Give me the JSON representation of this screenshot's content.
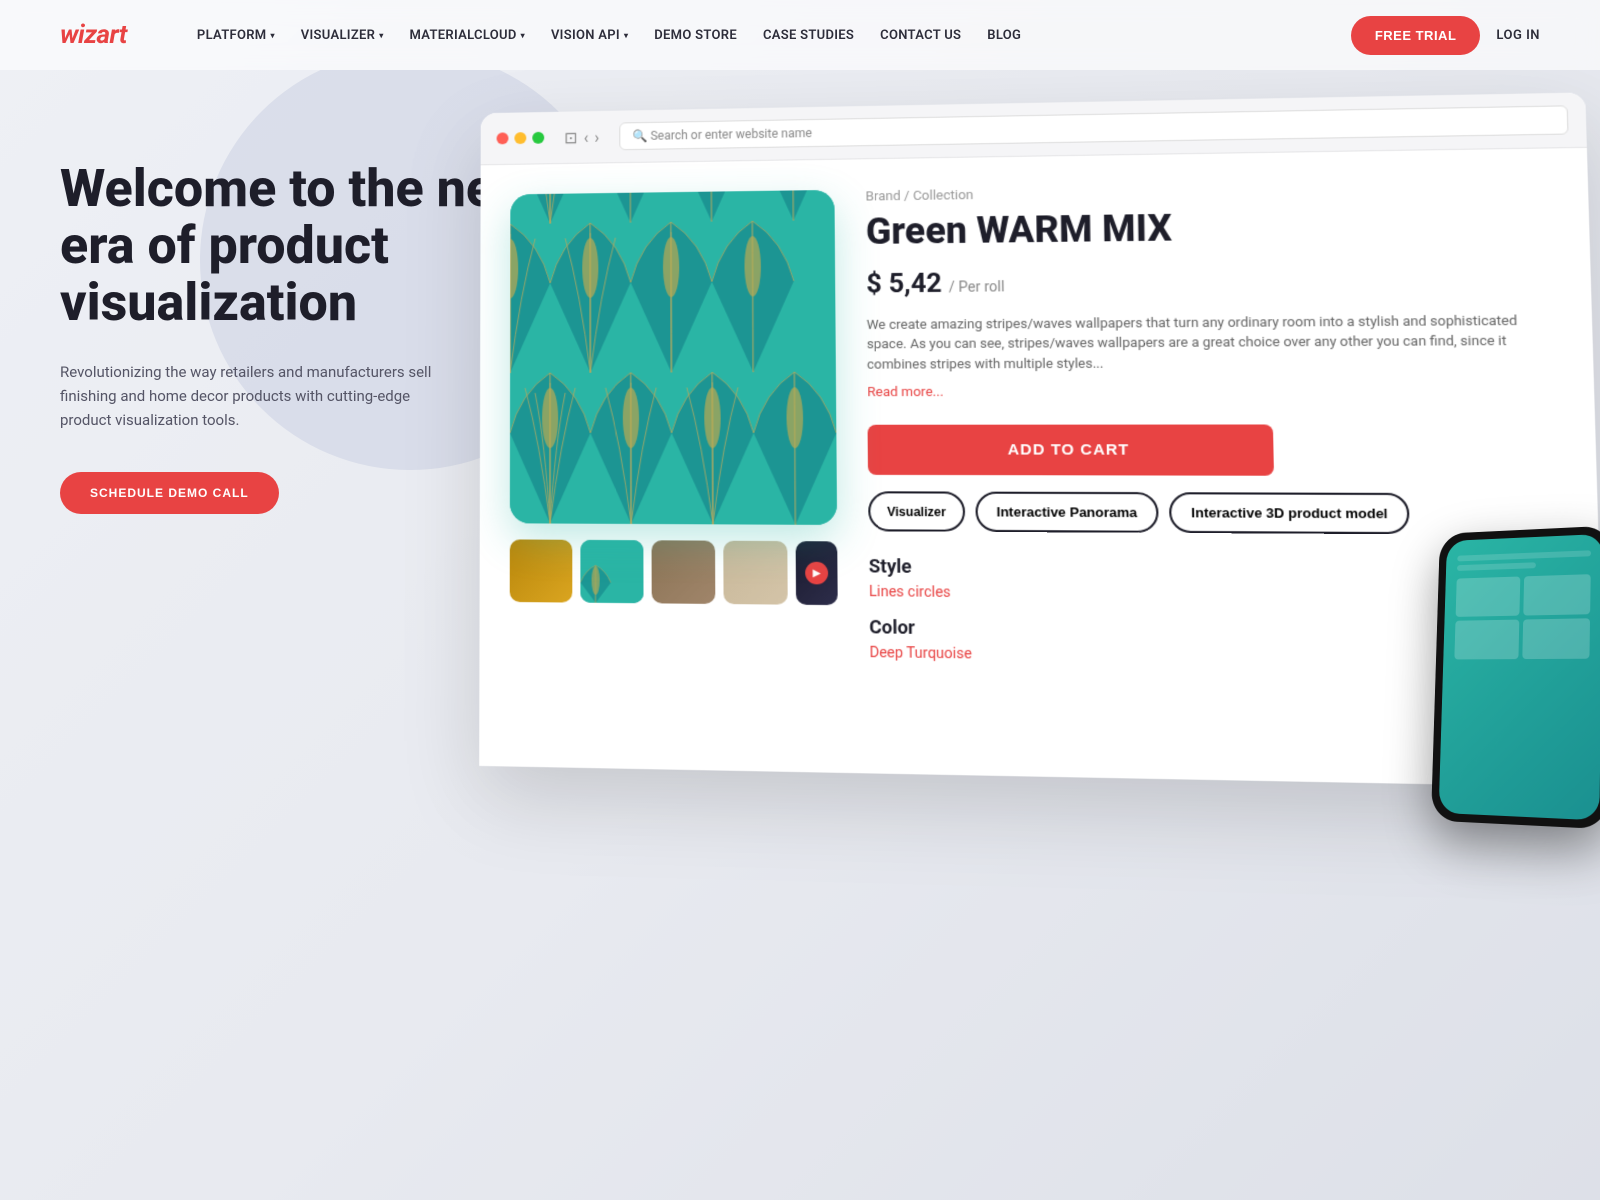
{
  "brand": {
    "logo": "wizart"
  },
  "nav": {
    "items": [
      {
        "label": "PLATFORM",
        "has_dropdown": true
      },
      {
        "label": "VISUALIZER",
        "has_dropdown": true
      },
      {
        "label": "MATERIALCLOUD",
        "has_dropdown": true
      },
      {
        "label": "VISION API",
        "has_dropdown": true
      },
      {
        "label": "DEMO STORE",
        "has_dropdown": false
      },
      {
        "label": "CASE STUDIES",
        "has_dropdown": false
      },
      {
        "label": "CONTACT US",
        "has_dropdown": false
      },
      {
        "label": "BLOG",
        "has_dropdown": false
      }
    ],
    "free_trial": "FREE TRIAL",
    "login": "LOG IN"
  },
  "hero": {
    "title": "Welcome to the new era of product visualization",
    "description": "Revolutionizing the way retailers and manufacturers sell finishing and home decor products with cutting-edge product visualization tools.",
    "cta": "SCHEDULE DEMO CALL"
  },
  "product": {
    "brand_collection": "Brand / Collection",
    "name": "Green WARM MIX",
    "price": "$ 5,42",
    "price_unit": "/ Per roll",
    "description": "We create amazing stripes/waves wallpapers that turn any ordinary room into a stylish and sophisticated space. As you can see, stripes/waves wallpapers are a great choice over any other you can find, since it combines stripes with multiple styles...",
    "read_more": "Read more...",
    "add_to_cart": "ADD TO CART",
    "feature_buttons": [
      "Visualizer",
      "Interactive Panorama",
      "Interactive 3D product model"
    ],
    "style_label": "Style",
    "style_value": "Lines circles",
    "color_label": "Color",
    "color_value": "Deep Turquoise",
    "search_placeholder": "Search or enter website name"
  }
}
